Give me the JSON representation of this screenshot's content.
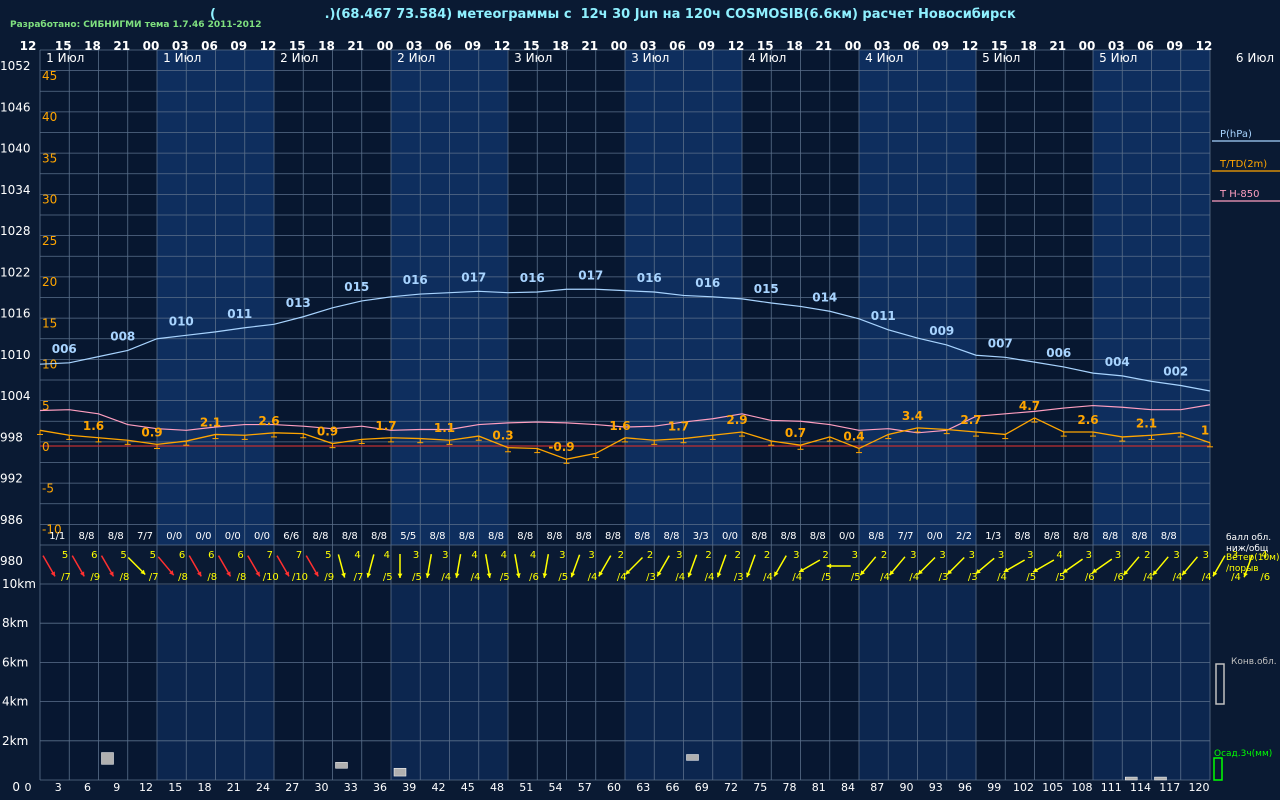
{
  "header": {
    "developer": "Разработано: СИБНИГМИ тема 1.7.46 2011-2012",
    "title": "(                        .)(68.467 73.584) метеограммы с  12ч 30 Jun на 120ч COSMOSIB(6.6км) расчет Новосибирск"
  },
  "chart_data": {
    "type": "line",
    "hour_ticks": [
      "12",
      "15",
      "18",
      "21",
      "00",
      "03",
      "06",
      "09",
      "12",
      "15",
      "18",
      "21",
      "00",
      "03",
      "06",
      "09",
      "12",
      "15",
      "18",
      "21",
      "00",
      "03",
      "06",
      "09",
      "12",
      "15",
      "18",
      "21",
      "00",
      "03",
      "06",
      "09",
      "12",
      "15",
      "18",
      "21",
      "00",
      "03",
      "06",
      "09",
      "12"
    ],
    "lead_hours": [
      "0",
      "3",
      "6",
      "9",
      "12",
      "15",
      "18",
      "21",
      "24",
      "27",
      "30",
      "33",
      "36",
      "39",
      "42",
      "45",
      "48",
      "51",
      "54",
      "57",
      "60",
      "63",
      "66",
      "69",
      "72",
      "75",
      "78",
      "81",
      "84",
      "87",
      "90",
      "93",
      "96",
      "99",
      "102",
      "105",
      "108",
      "111",
      "114",
      "117",
      "120"
    ],
    "day_labels": [
      {
        "step": 1,
        "text": "1 Июл"
      },
      {
        "step": 5,
        "text": "1 Июл"
      },
      {
        "step": 9,
        "text": "2 Июл"
      },
      {
        "step": 13,
        "text": "2 Июл"
      },
      {
        "step": 17,
        "text": "3 Июл"
      },
      {
        "step": 21,
        "text": "3 Июл"
      },
      {
        "step": 25,
        "text": "4 Июл"
      },
      {
        "step": 29,
        "text": "4 Июл"
      },
      {
        "step": 33,
        "text": "5 Июл"
      },
      {
        "step": 37,
        "text": "5 Июл"
      },
      {
        "step": 41,
        "text": "6 Июл"
      }
    ],
    "pressure_axis": {
      "label": "P(hPa)",
      "ticks": [
        "1052",
        "1046",
        "1040",
        "1034",
        "1028",
        "1022",
        "1016",
        "1010",
        "1004",
        "998",
        "992",
        "986",
        "980"
      ],
      "range": [
        980,
        1052
      ]
    },
    "temperature_axis": {
      "label": "T/TD(2m)",
      "ticks": [
        "45",
        "40",
        "35",
        "30",
        "25",
        "20",
        "15",
        "10",
        "5",
        "0",
        "-5",
        "-10"
      ],
      "range": [
        -12,
        48
      ]
    },
    "t850_label": "T H-850",
    "pressure": [
      1006.3,
      1006.5,
      1007.4,
      1008.3,
      1010.0,
      1010.5,
      1011.0,
      1011.6,
      1012.1,
      1013.2,
      1014.5,
      1015.5,
      1016.1,
      1016.5,
      1016.7,
      1016.9,
      1016.7,
      1016.8,
      1017.2,
      1017.2,
      1017.0,
      1016.8,
      1016.3,
      1016.1,
      1015.8,
      1015.2,
      1014.7,
      1014.0,
      1012.9,
      1011.3,
      1010.1,
      1009.1,
      1007.6,
      1007.3,
      1006.6,
      1005.9,
      1005.0,
      1004.6,
      1003.8,
      1003.2,
      1002.4
    ],
    "pressure_labels": [
      {
        "step": 1,
        "text": "006"
      },
      {
        "step": 3,
        "text": "008"
      },
      {
        "step": 5,
        "text": "010"
      },
      {
        "step": 7,
        "text": "011"
      },
      {
        "step": 9,
        "text": "013"
      },
      {
        "step": 11,
        "text": "015"
      },
      {
        "step": 13,
        "text": "016"
      },
      {
        "step": 15,
        "text": "017"
      },
      {
        "step": 17,
        "text": "016"
      },
      {
        "step": 19,
        "text": "017"
      },
      {
        "step": 21,
        "text": "016"
      },
      {
        "step": 23,
        "text": "016"
      },
      {
        "step": 25,
        "text": "015"
      },
      {
        "step": 27,
        "text": "014"
      },
      {
        "step": 29,
        "text": "011"
      },
      {
        "step": 31,
        "text": "009"
      },
      {
        "step": 33,
        "text": "007"
      },
      {
        "step": 35,
        "text": "006"
      },
      {
        "step": 37,
        "text": "004"
      },
      {
        "step": 39,
        "text": "002"
      }
    ],
    "temperature": [
      1.9,
      1.3,
      1.0,
      0.7,
      0.2,
      0.6,
      1.4,
      1.3,
      1.6,
      1.5,
      0.3,
      0.8,
      1.0,
      0.9,
      0.7,
      1.2,
      -0.2,
      -0.3,
      -1.6,
      -0.9,
      1.0,
      0.7,
      0.9,
      1.3,
      1.7,
      0.6,
      0.1,
      1.1,
      -0.3,
      1.4,
      2.2,
      2.0,
      1.7,
      1.4,
      3.4,
      1.7,
      1.7,
      1.1,
      1.3,
      1.6,
      0.4
    ],
    "temperature_labels": [
      {
        "step": 2,
        "text": "1.6"
      },
      {
        "step": 4,
        "text": "0.9"
      },
      {
        "step": 6,
        "text": "2.1"
      },
      {
        "step": 8,
        "text": "2.6"
      },
      {
        "step": 10,
        "text": "0.9"
      },
      {
        "step": 12,
        "text": "1.7"
      },
      {
        "step": 14,
        "text": "1.1"
      },
      {
        "step": 16,
        "text": "0.3"
      },
      {
        "step": 18,
        "text": "-0.9"
      },
      {
        "step": 20,
        "text": "1.6"
      },
      {
        "step": 22,
        "text": "1.7"
      },
      {
        "step": 24,
        "text": "2.9"
      },
      {
        "step": 26,
        "text": "0.7"
      },
      {
        "step": 28,
        "text": "0.4"
      },
      {
        "step": 30,
        "text": "3.4"
      },
      {
        "step": 32,
        "text": "2.7"
      },
      {
        "step": 34,
        "text": "4.7"
      },
      {
        "step": 36,
        "text": "2.6"
      },
      {
        "step": 38,
        "text": "2.1"
      },
      {
        "step": 40,
        "text": "1"
      }
    ],
    "t850": [
      4.3,
      4.4,
      3.9,
      2.6,
      2.1,
      1.9,
      2.3,
      2.6,
      2.6,
      2.4,
      2.1,
      2.4,
      1.9,
      2.0,
      2.0,
      2.6,
      2.8,
      2.9,
      2.8,
      2.6,
      2.3,
      2.4,
      2.9,
      3.3,
      3.9,
      3.1,
      3.0,
      2.6,
      1.9,
      2.1,
      1.6,
      1.9,
      3.6,
      3.9,
      4.2,
      4.6,
      4.9,
      4.7,
      4.4,
      4.4,
      5.0
    ],
    "cloud_axis_label": "балл обл.\nниж/общ",
    "cloud": [
      "1/1",
      "8/8",
      "8/8",
      "7/7",
      "0/0",
      "0/0",
      "0/0",
      "0/0",
      "6/6",
      "8/8",
      "8/8",
      "8/8",
      "5/5",
      "8/8",
      "8/8",
      "8/8",
      "8/8",
      "8/8",
      "8/8",
      "8/8",
      "8/8",
      "8/8",
      "3/3",
      "0/0",
      "8/8",
      "8/8",
      "8/8",
      "0/0",
      "8/8",
      "7/7",
      "0/0",
      "2/2",
      "1/3",
      "8/8",
      "8/8",
      "8/8",
      "8/8",
      "8/8",
      "8/8"
    ],
    "wind_axis_label": "Ветер(10м)\n/порыв",
    "wind": [
      {
        "s": "5",
        "g": "/7",
        "d": 330,
        "c": "#ff3030"
      },
      {
        "s": "6",
        "g": "/9",
        "d": 330,
        "c": "#ff3030"
      },
      {
        "s": "5",
        "g": "/8",
        "d": 330,
        "c": "#ff3030"
      },
      {
        "s": "5",
        "g": "/7",
        "d": 315,
        "c": "#ffff00"
      },
      {
        "s": "6",
        "g": "/8",
        "d": 320,
        "c": "#ff3030"
      },
      {
        "s": "6",
        "g": "/8",
        "d": 330,
        "c": "#ff3030"
      },
      {
        "s": "6",
        "g": "/8",
        "d": 330,
        "c": "#ff3030"
      },
      {
        "s": "7",
        "g": "/10",
        "d": 330,
        "c": "#ff3030"
      },
      {
        "s": "7",
        "g": "/10",
        "d": 330,
        "c": "#ff3030"
      },
      {
        "s": "5",
        "g": "/9",
        "d": 330,
        "c": "#ff3030"
      },
      {
        "s": "4",
        "g": "/7",
        "d": 345,
        "c": "#ffff00"
      },
      {
        "s": "4",
        "g": "/5",
        "d": 15,
        "c": "#ffff00"
      },
      {
        "s": "3",
        "g": "/5",
        "d": 0,
        "c": "#ffff00"
      },
      {
        "s": "3",
        "g": "/4",
        "d": 10,
        "c": "#ffff00"
      },
      {
        "s": "4",
        "g": "/4",
        "d": 10,
        "c": "#ffff00"
      },
      {
        "s": "4",
        "g": "/5",
        "d": 350,
        "c": "#ffff00"
      },
      {
        "s": "4",
        "g": "/6",
        "d": 350,
        "c": "#ffff00"
      },
      {
        "s": "3",
        "g": "/5",
        "d": 10,
        "c": "#ffff00"
      },
      {
        "s": "3",
        "g": "/4",
        "d": 20,
        "c": "#ffff00"
      },
      {
        "s": "2",
        "g": "/4",
        "d": 30,
        "c": "#ffff00"
      },
      {
        "s": "2",
        "g": "/3",
        "d": 45,
        "c": "#ffff00"
      },
      {
        "s": "3",
        "g": "/4",
        "d": 30,
        "c": "#ffff00"
      },
      {
        "s": "2",
        "g": "/4",
        "d": 20,
        "c": "#ffff00"
      },
      {
        "s": "2",
        "g": "/3",
        "d": 20,
        "c": "#ffff00"
      },
      {
        "s": "2",
        "g": "/4",
        "d": 20,
        "c": "#ffff00"
      },
      {
        "s": "3",
        "g": "/4",
        "d": 30,
        "c": "#ffff00"
      },
      {
        "s": "2",
        "g": "/5",
        "d": 60,
        "c": "#ffff00"
      },
      {
        "s": "3",
        "g": "/5",
        "d": 90,
        "c": "#ffff00"
      },
      {
        "s": "2",
        "g": "/4",
        "d": 40,
        "c": "#ffff00"
      },
      {
        "s": "3",
        "g": "/4",
        "d": 40,
        "c": "#ffff00"
      },
      {
        "s": "3",
        "g": "/3",
        "d": 45,
        "c": "#ffff00"
      },
      {
        "s": "3",
        "g": "/3",
        "d": 45,
        "c": "#ffff00"
      },
      {
        "s": "3",
        "g": "/4",
        "d": 50,
        "c": "#ffff00"
      },
      {
        "s": "3",
        "g": "/5",
        "d": 60,
        "c": "#ffff00"
      },
      {
        "s": "4",
        "g": "/5",
        "d": 60,
        "c": "#ffff00"
      },
      {
        "s": "3",
        "g": "/6",
        "d": 55,
        "c": "#ffff00"
      },
      {
        "s": "3",
        "g": "/6",
        "d": 55,
        "c": "#ffff00"
      },
      {
        "s": "2",
        "g": "/4",
        "d": 40,
        "c": "#ffff00"
      },
      {
        "s": "3",
        "g": "/4",
        "d": 40,
        "c": "#ffff00"
      },
      {
        "s": "3",
        "g": "/4",
        "d": 40,
        "c": "#ffff00"
      },
      {
        "s": "3",
        "g": "/4",
        "d": 30,
        "c": "#ffff00"
      },
      {
        "s": "4",
        "g": "/6",
        "d": 20,
        "c": "#ffff00"
      }
    ],
    "height_axis": {
      "ticks": [
        "10km",
        "8km",
        "6km",
        "4km",
        "2km",
        "0"
      ],
      "range": [
        0,
        11
      ]
    },
    "conv_label": "Конв.обл.",
    "precip_label": "Осад.3ч(мм)",
    "precip_bars": [
      {
        "step": 2,
        "km": 0.8,
        "h": 0.6
      },
      {
        "step": 10,
        "km": 0.6,
        "h": 0.3
      },
      {
        "step": 12,
        "km": 0.2,
        "h": 0.4
      },
      {
        "step": 22,
        "km": 1.0,
        "h": 0.3
      },
      {
        "step": 37,
        "km": 0.0,
        "h": 0.15
      },
      {
        "step": 38,
        "km": 0.0,
        "h": 0.15
      }
    ],
    "colors": {
      "background": "#0a1a33",
      "band_light": "#0e2e5e",
      "band_dark": "#071730",
      "grid": "#5a6f8a",
      "pressure": "#a8d4ff",
      "temperature": "#ffa500",
      "t850": "#ff9fc0",
      "zero_line": "#c03030",
      "white": "#ffffff",
      "cyan": "#8ff0ff",
      "green": "#00ff00"
    }
  }
}
